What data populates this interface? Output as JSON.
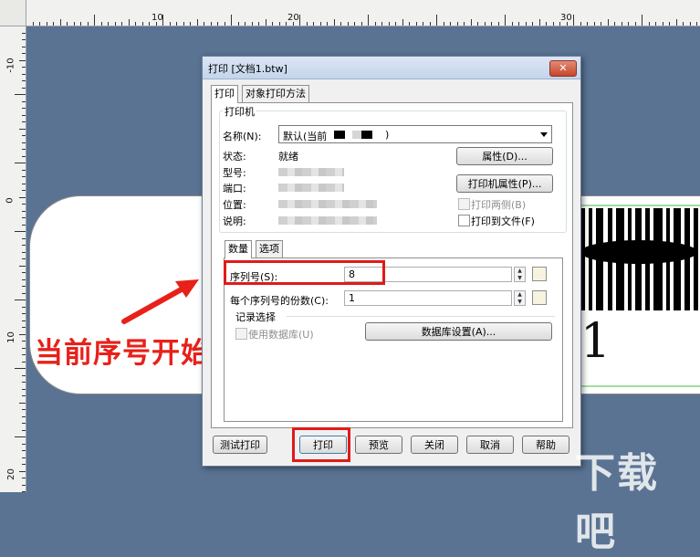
{
  "rulers": {
    "top": [
      "10",
      "20",
      "30"
    ],
    "left": [
      "-10",
      "0",
      "10",
      "20"
    ]
  },
  "canvas": {
    "label_number": "1"
  },
  "annotation": {
    "text": "当前序号开始打多少个",
    "color": "#e8201a"
  },
  "dialog": {
    "title": "打印 [文档1.btw]",
    "close_glyph": "✕",
    "tabs": [
      "打印",
      "对象打印方法"
    ],
    "printer_group": {
      "legend": "打印机",
      "name_label": "名称(N):",
      "name_value": "默认(当前",
      "name_suffix": ")",
      "status_label": "状态:",
      "status_value": "就绪",
      "model_label": "型号:",
      "port_label": "端口:",
      "location_label": "位置:",
      "comment_label": "说明:",
      "properties_button": "属性(D)...",
      "printer_properties_button": "打印机属性(P)...",
      "duplex_label": "打印两侧(B)",
      "print_to_file_label": "打印到文件(F)"
    },
    "inner_tabs": [
      "数量",
      "选项"
    ],
    "quantity": {
      "serial_label": "序列号(S):",
      "serial_value": "8",
      "copies_label": "每个序列号的份数(C):",
      "copies_value": "1"
    },
    "records": {
      "legend": "记录选择",
      "use_database_label": "使用数据库(U)",
      "database_settings_button": "数据库设置(A)..."
    },
    "buttons": {
      "test_print": "测试打印",
      "print": "打印",
      "preview": "预览",
      "close": "关闭",
      "cancel": "取消",
      "help": "帮助"
    },
    "highlight_color": "#e01a1a"
  },
  "watermark": {
    "text": "下载吧"
  }
}
